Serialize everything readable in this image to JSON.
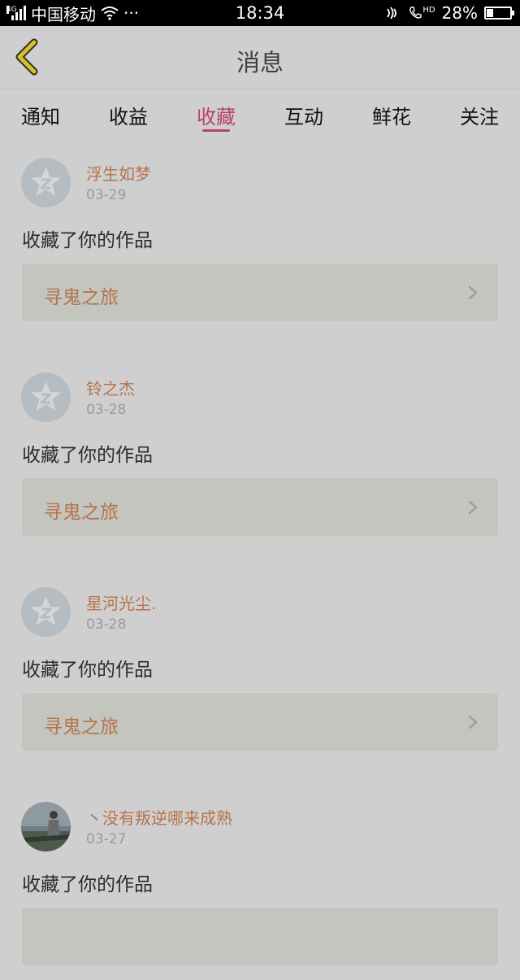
{
  "status_bar": {
    "network_type": "4G",
    "carrier": "中国移动",
    "more": "···",
    "time": "18:34",
    "hd_label": "HD",
    "battery_percent": "28%",
    "battery_level": 0.28
  },
  "header": {
    "title": "消息"
  },
  "tabs": [
    {
      "label": "通知"
    },
    {
      "label": "收益"
    },
    {
      "label": "收藏",
      "active": true
    },
    {
      "label": "互动"
    },
    {
      "label": "鲜花"
    },
    {
      "label": "关注"
    }
  ],
  "feed": [
    {
      "name": "浮生如梦",
      "date": "03-29",
      "message": "收藏了你的作品",
      "work": "寻鬼之旅",
      "avatar": "default-qq-avatar"
    },
    {
      "name": "铃之杰",
      "date": "03-28",
      "message": "收藏了你的作品",
      "work": "寻鬼之旅",
      "avatar": "default-qq-avatar"
    },
    {
      "name": "星河光尘.",
      "date": "03-28",
      "message": "收藏了你的作品",
      "work": "寻鬼之旅",
      "avatar": "default-qq-avatar"
    },
    {
      "name": "丶没有叛逆哪来成熟",
      "date": "03-27",
      "message": "收藏了你的作品",
      "work": "",
      "avatar": "photo-avatar"
    }
  ],
  "colors": {
    "accent": "#b9426a",
    "username": "#b5744c",
    "back_arrow": "#d6c227"
  }
}
